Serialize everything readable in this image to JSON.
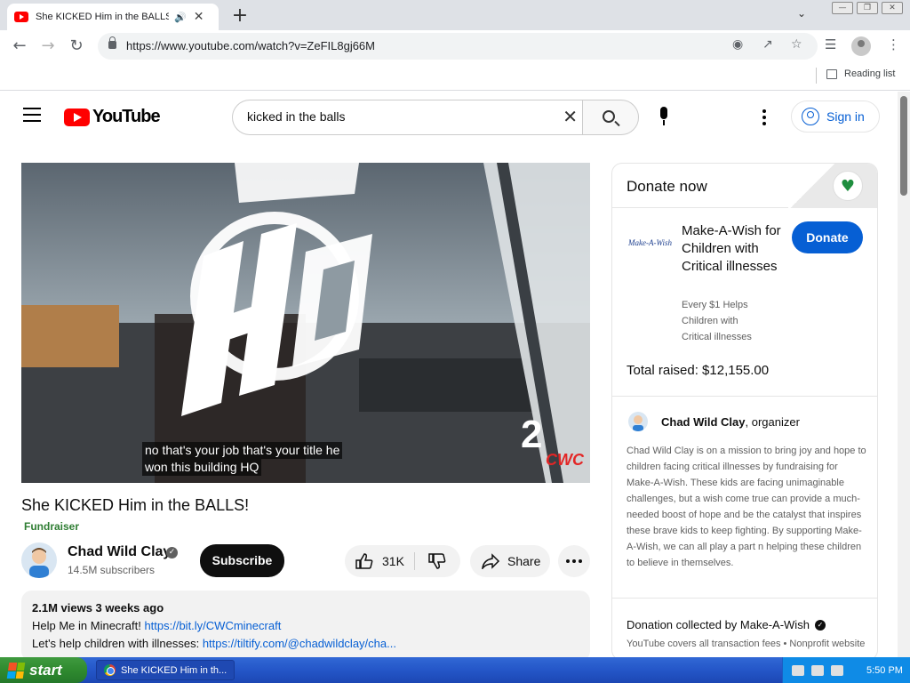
{
  "browser": {
    "tab_title": "She KICKED Him in the BALLS!",
    "tab_audio_icon": "speaker-icon",
    "new_tab_label": "+",
    "url": "https://www.youtube.com/watch?v=ZeFIL8gj66M",
    "reading_list_label": "Reading list"
  },
  "youtube": {
    "logo_word": "YouTube",
    "search_query": "kicked in the balls",
    "sign_in_label": "Sign in",
    "video": {
      "caption_line1": "no that's your job that's your title he",
      "caption_line2": "won this building HQ"
    },
    "title": "She KICKED Him in the BALLS!",
    "fundraiser_label": "Fundraiser",
    "channel": {
      "name": "Chad Wild Clay",
      "subscribers": "14.5M subscribers",
      "subscribe_label": "Subscribe"
    },
    "actions": {
      "likes": "31K",
      "share_label": "Share"
    },
    "description": {
      "stats": "2.1M views  3 weeks ago",
      "line2_text": "Help Me in Minecraft! ",
      "line2_link": "https://bit.ly/CWCminecraft",
      "line3_text": "Let's help children with illnesses: ",
      "line3_link": "https://tiltify.com/@chadwildclay/cha..."
    },
    "donate": {
      "heading": "Donate now",
      "org_logo_text": "Make-A-Wish",
      "org_name": "Make-A-Wish for Children with Critical illnesses",
      "org_tagline": "Every $1 Helps Children with Critical illnesses",
      "donate_label": "Donate",
      "raised": "Total raised: $12,155.00",
      "organizer_name": "Chad Wild Clay",
      "organizer_role": ", organizer",
      "mission": "Chad Wild Clay is on a mission to bring joy and hope to children facing critical illnesses by fundraising for Make-A-Wish. These kids are facing unimaginable challenges, but a wish come true can provide a much-needed boost of hope and be the catalyst that inspires these brave kids to keep fighting. By supporting Make-A-Wish, we can all play a part n helping these children to believe in themselves.",
      "collected_by": "Donation collected by Make-A-Wish",
      "fees_note": "YouTube covers all transaction fees  •  Nonprofit website"
    }
  },
  "taskbar": {
    "start_label": "start",
    "task_label": "She KICKED Him in th...",
    "clock": "5:50 PM"
  },
  "colors": {
    "youtube_red": "#ff0000",
    "link_blue": "#065fd4",
    "fundraiser_green": "#2e7d32",
    "xp_taskbar": "#2456c8"
  }
}
